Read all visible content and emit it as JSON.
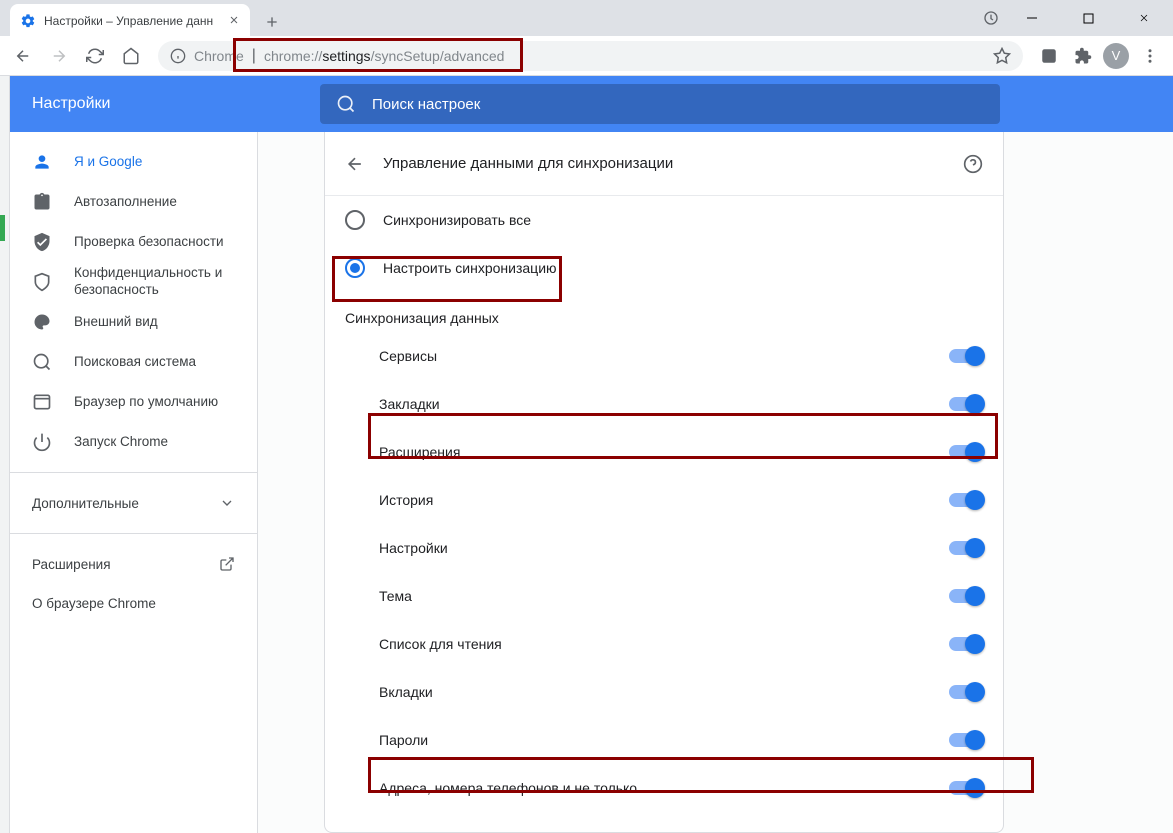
{
  "window": {
    "tab_title": "Настройки – Управление данн",
    "minimize": "—",
    "maximize": "☐",
    "close": "✕"
  },
  "toolbar": {
    "chrome_label": "Chrome",
    "url_pre": "chrome://",
    "url_bold": "settings",
    "url_post": "/syncSetup/advanced",
    "avatar_letter": "V"
  },
  "settings": {
    "title": "Настройки",
    "search_placeholder": "Поиск настроек"
  },
  "sidebar": {
    "items": [
      {
        "label": "Я и Google"
      },
      {
        "label": "Автозаполнение"
      },
      {
        "label": "Проверка безопасности"
      },
      {
        "label": "Конфиденциальность и безопасность"
      },
      {
        "label": "Внешний вид"
      },
      {
        "label": "Поисковая система"
      },
      {
        "label": "Браузер по умолчанию"
      },
      {
        "label": "Запуск Chrome"
      }
    ],
    "advanced": "Дополнительные",
    "extensions": "Расширения",
    "about": "О браузере Chrome"
  },
  "main": {
    "page_title": "Управление данными для синхронизации",
    "radio_all": "Синхронизировать все",
    "radio_custom": "Настроить синхронизацию",
    "section": "Синхронизация данных",
    "toggles": [
      {
        "label": "Сервисы"
      },
      {
        "label": "Закладки"
      },
      {
        "label": "Расширения"
      },
      {
        "label": "История"
      },
      {
        "label": "Настройки"
      },
      {
        "label": "Тема"
      },
      {
        "label": "Список для чтения"
      },
      {
        "label": "Вкладки"
      },
      {
        "label": "Пароли"
      },
      {
        "label": "Адреса, номера телефонов и не только"
      }
    ]
  }
}
